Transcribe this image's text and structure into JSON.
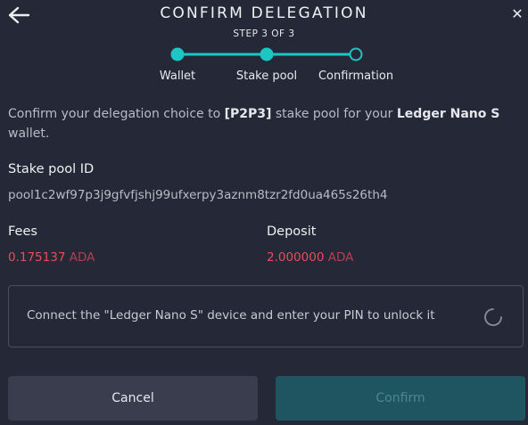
{
  "header": {
    "title": "CONFIRM DELEGATION",
    "step_text": "STEP 3 OF 3",
    "close_glyph": "✕"
  },
  "steps": [
    {
      "label": "Wallet",
      "state": "done"
    },
    {
      "label": "Stake pool",
      "state": "done"
    },
    {
      "label": "Confirmation",
      "state": "current"
    }
  ],
  "intro": {
    "prefix": "Confirm your delegation choice to ",
    "pool_ticker": "[P2P3]",
    "middle": " stake pool for your ",
    "wallet_name": "Ledger Nano S",
    "suffix": " wallet."
  },
  "stake_pool": {
    "label": "Stake pool ID",
    "id": "pool1c2wf97p3j9gfvfjshj99ufxerpy3aznm8tzr2fd0ua465s26th4"
  },
  "fees": {
    "label": "Fees",
    "amount": "0.175137",
    "currency": "ADA"
  },
  "deposit": {
    "label": "Deposit",
    "amount": "2.000000",
    "currency": "ADA"
  },
  "hardware": {
    "message": "Connect the \"Ledger Nano S\" device and enter your PIN to unlock it"
  },
  "buttons": {
    "cancel": "Cancel",
    "confirm": "Confirm"
  },
  "colors": {
    "background": "#252836",
    "accent": "#1cc6c4",
    "fee": "#ea4c5b",
    "confirm_button": "#1f5560",
    "cancel_button": "#3a3d4e"
  },
  "icons": {
    "back": "arrow-left-icon",
    "close": "close-icon",
    "spinner": "spinner-icon"
  }
}
